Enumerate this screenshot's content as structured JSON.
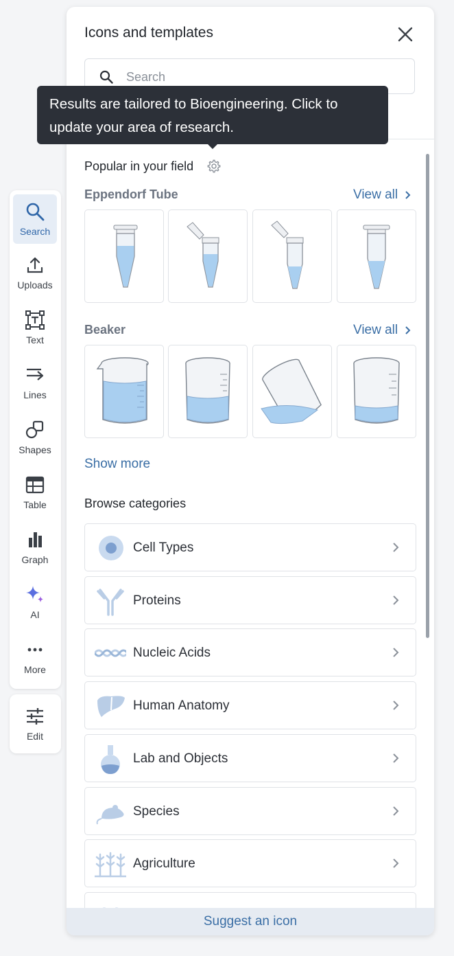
{
  "toolbar": {
    "items": [
      {
        "label": "Search",
        "icon": "search-icon"
      },
      {
        "label": "Uploads",
        "icon": "upload-icon"
      },
      {
        "label": "Text",
        "icon": "text-box-icon"
      },
      {
        "label": "Lines",
        "icon": "arrow-line-icon"
      },
      {
        "label": "Shapes",
        "icon": "shapes-icon"
      },
      {
        "label": "Table",
        "icon": "table-icon"
      },
      {
        "label": "Graph",
        "icon": "bar-graph-icon"
      },
      {
        "label": "AI",
        "icon": "sparkle-icon"
      },
      {
        "label": "More",
        "icon": "more-dots-icon"
      }
    ],
    "edit_label": "Edit",
    "active_item": "Search"
  },
  "panel": {
    "title": "Icons and templates",
    "search_placeholder": "Search",
    "tooltip": "Results are tailored to Bioengineering. Click to update your area of research.",
    "popular_heading": "Popular in your field",
    "groups": [
      {
        "name": "Eppendorf Tube",
        "view_all": "View all",
        "tiles": [
          "eppendorf-tube-closed",
          "eppendorf-tube-open",
          "eppendorf-tube-open-small",
          "eppendorf-tube-closed-low"
        ]
      },
      {
        "name": "Beaker",
        "view_all": "View all",
        "tiles": [
          "beaker-full",
          "beaker-half",
          "beaker-tilted",
          "beaker-low"
        ]
      }
    ],
    "show_more": "Show more",
    "categories_heading": "Browse categories",
    "categories": [
      {
        "label": "Cell Types",
        "icon": "cell-icon"
      },
      {
        "label": "Proteins",
        "icon": "antibody-icon"
      },
      {
        "label": "Nucleic Acids",
        "icon": "dna-icon"
      },
      {
        "label": "Human Anatomy",
        "icon": "liver-icon"
      },
      {
        "label": "Lab and Objects",
        "icon": "flask-icon"
      },
      {
        "label": "Species",
        "icon": "mouse-icon"
      },
      {
        "label": "Agriculture",
        "icon": "wheat-icon"
      }
    ],
    "footer_link": "Suggest an icon"
  },
  "colors": {
    "accent": "#3a6ea5",
    "active_bg": "#e6edf6",
    "tooltip_bg": "#2c3038",
    "icon_fill": "#b9cde6"
  }
}
